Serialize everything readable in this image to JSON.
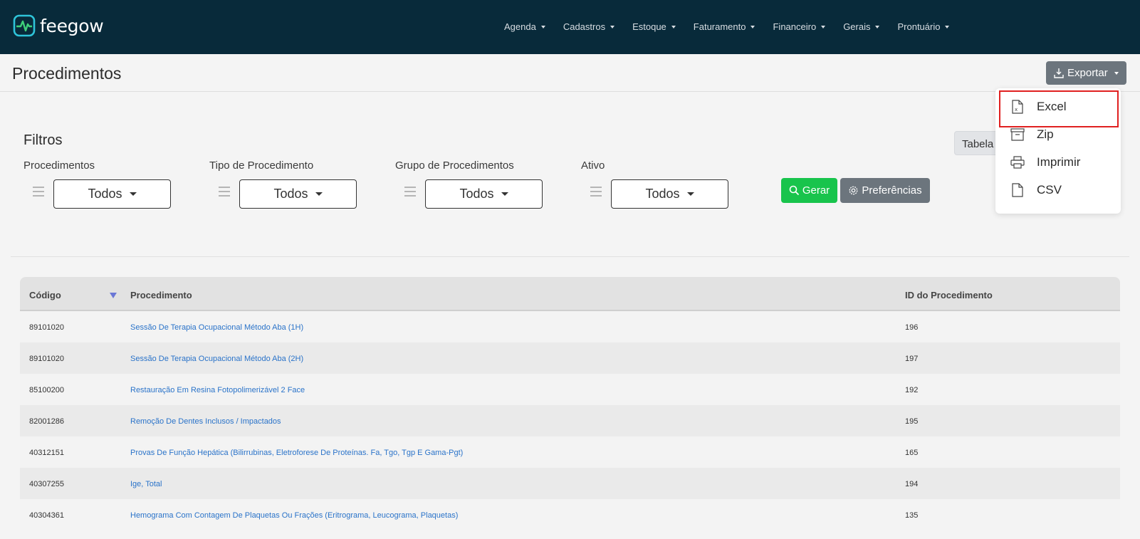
{
  "brand": {
    "name": "feegow"
  },
  "nav": {
    "items": [
      "Agenda",
      "Cadastros",
      "Estoque",
      "Faturamento",
      "Financeiro",
      "Gerais",
      "Prontuário"
    ]
  },
  "page": {
    "title": "Procedimentos"
  },
  "export": {
    "label": "Exportar",
    "options": [
      "Excel",
      "Zip",
      "Imprimir",
      "CSV"
    ]
  },
  "filters": {
    "title": "Filtros",
    "view_label": "Tabela",
    "groups": [
      {
        "label": "Procedimentos",
        "value": "Todos"
      },
      {
        "label": "Tipo de Procedimento",
        "value": "Todos"
      },
      {
        "label": "Grupo de Procedimentos",
        "value": "Todos"
      },
      {
        "label": "Ativo",
        "value": "Todos"
      }
    ],
    "gerar_label": "Gerar",
    "pref_label": "Preferências"
  },
  "table": {
    "headers": [
      "Código",
      "Procedimento",
      "ID do Procedimento"
    ],
    "rows": [
      {
        "codigo": "89101020",
        "procedimento": "Sessão De Terapia Ocupacional Método Aba (1H)",
        "id": "196"
      },
      {
        "codigo": "89101020",
        "procedimento": "Sessão De Terapia Ocupacional Método Aba (2H)",
        "id": "197"
      },
      {
        "codigo": "85100200",
        "procedimento": "Restauração Em Resina Fotopolimerizável 2 Face",
        "id": "192"
      },
      {
        "codigo": "82001286",
        "procedimento": "Remoção De Dentes Inclusos / Impactados",
        "id": "195"
      },
      {
        "codigo": "40312151",
        "procedimento": "Provas De Função Hepática (Bilirrubinas, Eletroforese De Proteínas. Fa, Tgo, Tgp E Gama-Pgt)",
        "id": "165"
      },
      {
        "codigo": "40307255",
        "procedimento": "Ige, Total",
        "id": "194"
      },
      {
        "codigo": "40304361",
        "procedimento": "Hemograma Com Contagem De Plaquetas Ou Frações (Eritrograma, Leucograma, Plaquetas)",
        "id": "135"
      }
    ]
  },
  "colors": {
    "topbar": "#082a3a",
    "accent_green": "#18c44c",
    "secondary": "#6c757d",
    "link": "#2a73c9",
    "highlight": "#e02020"
  }
}
